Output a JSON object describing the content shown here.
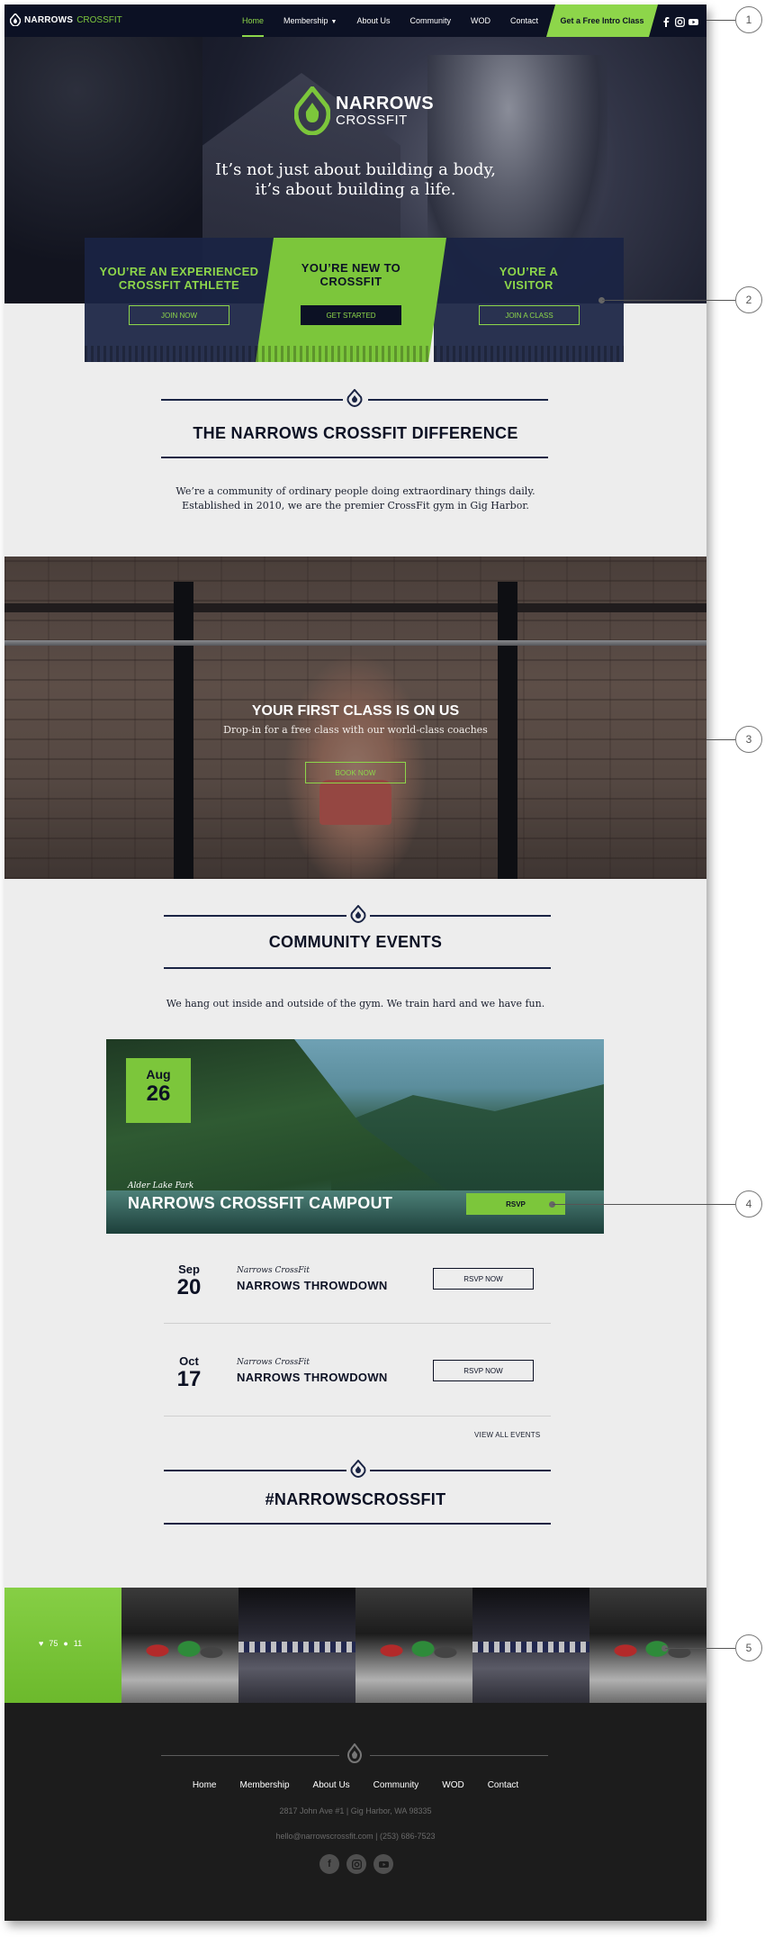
{
  "nav": {
    "logo_bold": "NARROWS",
    "logo_light": "CROSSFIT",
    "items": [
      {
        "label": "Home",
        "active": true
      },
      {
        "label": "Membership",
        "dropdown": true
      },
      {
        "label": "About Us"
      },
      {
        "label": "Community"
      },
      {
        "label": "WOD"
      },
      {
        "label": "Contact"
      }
    ],
    "cta": "Get a Free Intro Class",
    "social_icons": [
      "facebook-icon",
      "instagram-icon",
      "youtube-icon"
    ]
  },
  "hero": {
    "logo_line1": "NARROWS",
    "logo_line2": "CROSSFIT",
    "tagline_line1": "It’s not just about building a body,",
    "tagline_line2": "it’s about building a life."
  },
  "paths": [
    {
      "title_line1": "YOU’RE AN EXPERIENCED",
      "title_line2": "CROSSFIT ATHLETE",
      "button": "JOIN NOW"
    },
    {
      "title_line1": "YOU’RE NEW TO",
      "title_line2": "CROSSFIT",
      "button": "GET STARTED"
    },
    {
      "title_line1": "YOU’RE A",
      "title_line2": "VISITOR",
      "button": "JOIN A CLASS"
    }
  ],
  "difference": {
    "title": "THE NARROWS CROSSFIT DIFFERENCE",
    "body_line1": "We’re a community of ordinary people doing extraordinary things daily.",
    "body_line2": "Established in 2010, we are the premier CrossFit gym in Gig Harbor."
  },
  "banner": {
    "title": "YOUR FIRST CLASS IS ON US",
    "subtitle": "Drop-in for a free class with our world-class coaches",
    "button": "BOOK NOW"
  },
  "events": {
    "title": "COMMUNITY EVENTS",
    "intro": "We hang out inside and outside of the gym. We train hard and we have fun.",
    "featured": {
      "month": "Aug",
      "day": "26",
      "location": "Alder Lake Park",
      "name": "NARROWS CROSSFIT CAMPOUT",
      "button": "RSVP"
    },
    "list": [
      {
        "month": "Sep",
        "day": "20",
        "organizer": "Narrows CrossFit",
        "name": "NARROWS THROWDOWN",
        "button": "RSVP NOW"
      },
      {
        "month": "Oct",
        "day": "17",
        "organizer": "Narrows CrossFit",
        "name": "NARROWS THROWDOWN",
        "button": "RSVP NOW"
      }
    ],
    "view_all": "VIEW ALL EVENTS"
  },
  "hashtag": {
    "title": "#NARROWSCROSSFIT",
    "likes": "75",
    "comments": "11"
  },
  "footer": {
    "menu": [
      "Home",
      "Membership",
      "About Us",
      "Community",
      "WOD",
      "Contact"
    ],
    "address": "2817 John Ave #1 | Gig Harbor, WA 98335",
    "contact": "hello@narrowscrossfit.com | (253) 686-7523",
    "social_icons": [
      "facebook-icon",
      "instagram-icon",
      "youtube-icon"
    ]
  },
  "callouts": [
    "1",
    "2",
    "3",
    "4",
    "5"
  ],
  "colors": {
    "navy": "#0c1124",
    "accent_green": "#8dd64a",
    "page_bg": "#ededed",
    "footer_bg": "#1c1c1c"
  }
}
